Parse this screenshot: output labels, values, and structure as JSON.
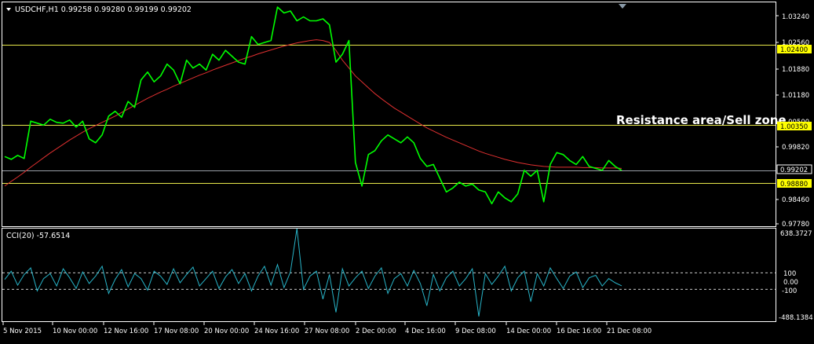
{
  "main_panel": {
    "symbol_info": "USDCHF,H1  0.99258 0.99280 0.99199 0.99202",
    "annotation": "Resistance area/Sell zone",
    "price_axis_ticks": [
      "1.03240",
      "1.02560",
      "1.01880",
      "1.01180",
      "1.00500",
      "0.99820",
      "0.98460",
      "0.97780"
    ],
    "hlines": [
      {
        "value": 1.024,
        "label": "1.02400",
        "color": "#e8e84a",
        "tag_bg": "#ffff00",
        "tag_fg": "#000000"
      },
      {
        "value": 1.0035,
        "label": "1.00350",
        "color": "#e8e84a",
        "tag_bg": "#ffff00",
        "tag_fg": "#000000"
      },
      {
        "value": 0.9888,
        "label": "0.98880",
        "color": "#e8e84a",
        "tag_bg": "#ffff00",
        "tag_fg": "#000000"
      },
      {
        "value": 0.99202,
        "label": "0.99202",
        "color": "#9aa0a8",
        "tag_bg": "#000000",
        "tag_fg": "#ffffff"
      }
    ],
    "colors": {
      "price": "#00ff00",
      "ma": "#e03030",
      "frame": "#ffffff"
    }
  },
  "cci_panel": {
    "label": "CCI(20) -57.6514",
    "axis_ticks": [
      "638.3727",
      "100",
      "0.00",
      "-100",
      "-488.1384"
    ],
    "range": [
      -488.1384,
      638.3727
    ],
    "levels": [
      100,
      -100
    ],
    "color": "#28b4c8"
  },
  "time_axis": {
    "labels": [
      "5 Nov 2015",
      "10 Nov 00:00",
      "12 Nov 16:00",
      "17 Nov 08:00",
      "20 Nov 00:00",
      "24 Nov 16:00",
      "27 Nov 08:00",
      "2 Dec 00:00",
      "4 Dec 16:00",
      "9 Dec 08:00",
      "14 Dec 00:00",
      "16 Dec 16:00",
      "21 Dec 08:00"
    ]
  },
  "chart_data": {
    "type": "line",
    "symbol": "USDCHF",
    "timeframe": "H1",
    "ylim": [
      0.9778,
      1.0347
    ],
    "series": [
      {
        "name": "USDCHF",
        "values": [
          0.9955,
          0.9948,
          0.9958,
          0.995,
          1.0045,
          1.004,
          1.0035,
          1.005,
          1.0042,
          1.004,
          1.0048,
          1.003,
          1.0045,
          1.0,
          0.999,
          1.001,
          1.0058,
          1.007,
          1.0055,
          1.0095,
          1.008,
          1.015,
          1.017,
          1.0145,
          1.016,
          1.019,
          1.0175,
          1.014,
          1.02,
          1.018,
          1.019,
          1.0175,
          1.0215,
          1.02,
          1.0225,
          1.021,
          1.0195,
          1.019,
          1.026,
          1.024,
          1.0245,
          1.025,
          1.0335,
          1.032,
          1.0325,
          1.03,
          1.031,
          1.03,
          1.03,
          1.0305,
          1.029,
          1.0195,
          1.0215,
          1.025,
          0.994,
          0.988,
          0.996,
          0.997,
          0.9995,
          1.001,
          1.0,
          0.999,
          1.0005,
          0.999,
          0.995,
          0.993,
          0.9935,
          0.99,
          0.9865,
          0.9875,
          0.989,
          0.988,
          0.9885,
          0.987,
          0.9865,
          0.9835,
          0.9865,
          0.985,
          0.984,
          0.986,
          0.992,
          0.9905,
          0.992,
          0.984,
          0.9935,
          0.9965,
          0.996,
          0.9945,
          0.9935,
          0.9955,
          0.993,
          0.9925,
          0.992,
          0.9945,
          0.993,
          0.992
        ]
      },
      {
        "name": "MA",
        "values": [
          0.988,
          0.9892,
          0.9903,
          0.9915,
          0.9928,
          0.994,
          0.9952,
          0.9964,
          0.9975,
          0.9986,
          0.9997,
          1.0007,
          1.0017,
          1.0026,
          1.0034,
          1.0042,
          1.005,
          1.0058,
          1.0067,
          1.0076,
          1.0085,
          1.0094,
          1.0103,
          1.0111,
          1.0119,
          1.0126,
          1.0134,
          1.0141,
          1.0148,
          1.0155,
          1.0162,
          1.0168,
          1.0175,
          1.0181,
          1.0187,
          1.0193,
          1.0199,
          1.0205,
          1.021,
          1.0216,
          1.0221,
          1.0226,
          1.0231,
          1.0236,
          1.024,
          1.0244,
          1.0247,
          1.025,
          1.0252,
          1.025,
          1.0245,
          1.0225,
          1.02,
          1.018,
          1.016,
          1.0145,
          1.013,
          1.0115,
          1.0102,
          1.009,
          1.0078,
          1.0068,
          1.0058,
          1.0048,
          1.0038,
          1.0028,
          1.002,
          1.0012,
          1.0004,
          0.9997,
          0.999,
          0.9983,
          0.9976,
          0.9969,
          0.9963,
          0.9958,
          0.9953,
          0.9948,
          0.9944,
          0.994,
          0.9937,
          0.9934,
          0.9932,
          0.993,
          0.9929,
          0.9928,
          0.9928,
          0.9928,
          0.9928,
          0.9927,
          0.9927,
          0.9927,
          0.9926,
          0.9926,
          0.9926,
          0.9925
        ]
      }
    ],
    "cci_values": [
      20,
      120,
      -50,
      80,
      160,
      -120,
      30,
      90,
      -60,
      150,
      40,
      -90,
      110,
      -30,
      60,
      180,
      -150,
      20,
      140,
      -70,
      90,
      30,
      -110,
      120,
      60,
      -40,
      150,
      -20,
      80,
      170,
      -60,
      30,
      120,
      -90,
      50,
      140,
      -30,
      90,
      -120,
      60,
      180,
      -50,
      200,
      -80,
      110,
      638,
      -100,
      60,
      120,
      -220,
      80,
      -380,
      150,
      -60,
      40,
      120,
      -90,
      60,
      160,
      -150,
      30,
      90,
      -60,
      130,
      -30,
      -300,
      80,
      -120,
      40,
      120,
      -60,
      30,
      150,
      -430,
      90,
      -40,
      60,
      180,
      -120,
      40,
      120,
      -250,
      90,
      -60,
      160,
      30,
      -90,
      60,
      110,
      -80,
      40,
      70,
      -60,
      30,
      -20,
      -58
    ]
  }
}
